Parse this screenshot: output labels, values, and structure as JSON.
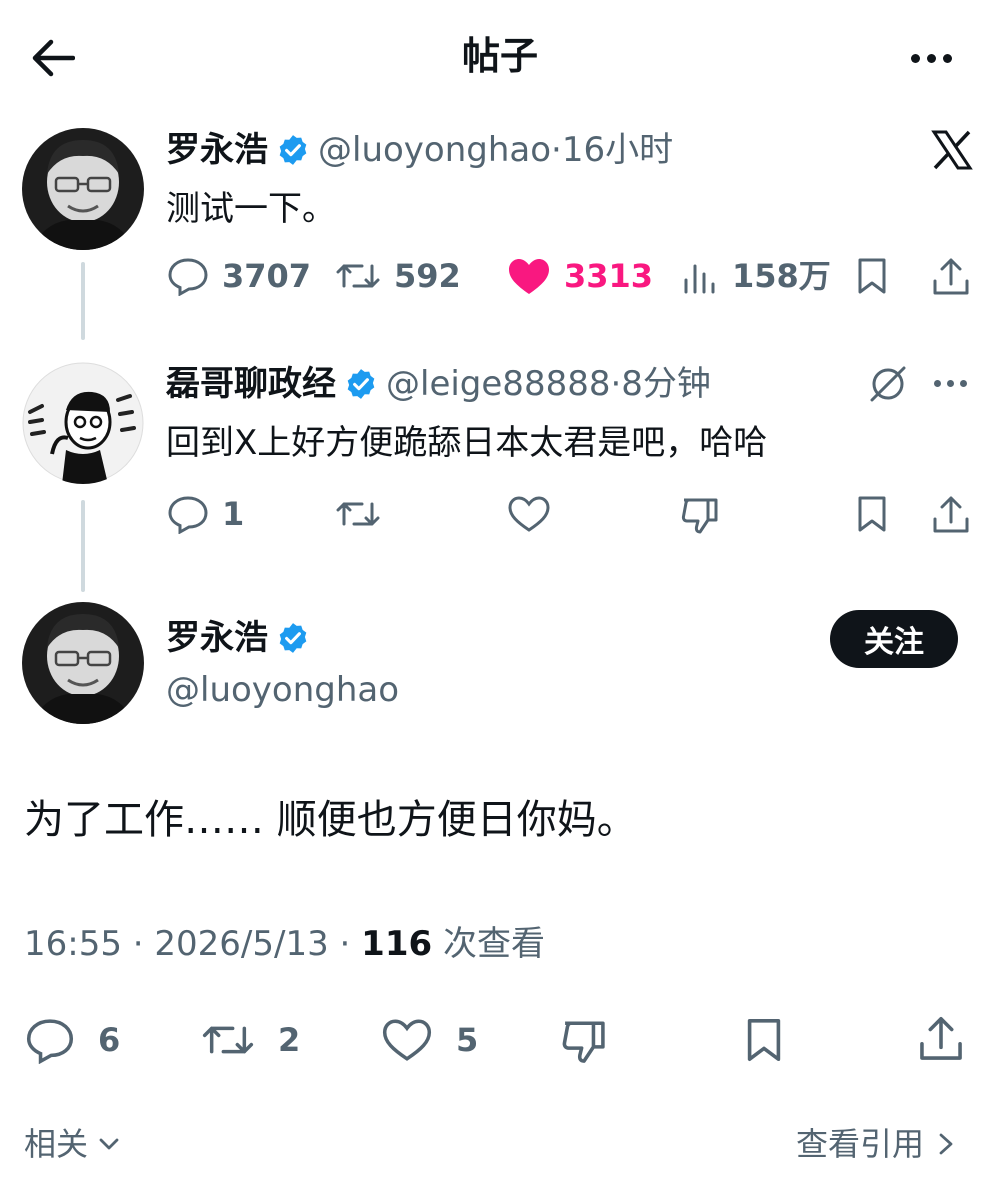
{
  "header": {
    "title": "帖子"
  },
  "tweets": [
    {
      "name": "罗永浩",
      "handle": "@luoyonghao",
      "time": "·16小时",
      "text": "测试一下。",
      "stats": {
        "replies": "3707",
        "reposts": "592",
        "likes": "3313",
        "views": "158万"
      }
    },
    {
      "name": "磊哥聊政经",
      "handle": "@leige88888",
      "time": "·8分钟",
      "text": "回到X上好方便跪舔日本太君是吧，哈哈",
      "stats": {
        "replies": "1"
      }
    }
  ],
  "main": {
    "name": "罗永浩",
    "handle": "@luoyonghao",
    "follow_label": "关注",
    "text": "为了工作…… 顺便也方便日你妈。",
    "timestamp": "16:55 · 2026/5/13 · ",
    "views_count": "116",
    "views_label": " 次查看",
    "stats": {
      "replies": "6",
      "reposts": "2",
      "likes": "5"
    }
  },
  "footer": {
    "related": "相关",
    "quotes": "查看引用"
  },
  "colors": {
    "like_active": "#f91880",
    "verified": "#1d9bf0",
    "text_primary": "#0f1419",
    "text_secondary": "#536471"
  },
  "icons": [
    "back-arrow-icon",
    "more-icon",
    "x-logo-icon",
    "verified-icon",
    "reply-icon",
    "repost-icon",
    "like-icon",
    "views-icon",
    "bookmark-icon",
    "share-icon",
    "grok-icon",
    "dislike-icon",
    "chevron-down-icon",
    "chevron-right-icon"
  ]
}
